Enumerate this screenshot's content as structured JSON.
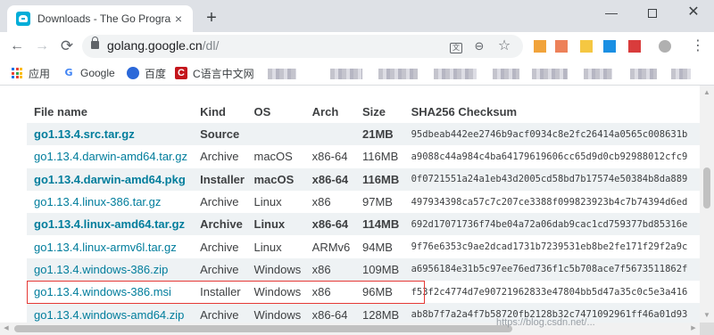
{
  "browser": {
    "tab_title": "Downloads - The Go Programming Language",
    "tab_close": "×",
    "new_tab": "+",
    "window_controls": {
      "minimize": "—",
      "close": "✕"
    },
    "nav": {
      "back": "←",
      "forward": "→",
      "reload": "⟳"
    },
    "url": {
      "host": "golang.google.cn",
      "path": "/dl/"
    },
    "omnibox_icons": {
      "translate": "文",
      "zoom": "⊖",
      "star": "☆"
    },
    "menu": "⋮",
    "extension_colors": [
      "#f1a33b",
      "#e8622f",
      "#f5c742",
      "#1a8fe3",
      "#d93c3c",
      "#7c7c7c"
    ]
  },
  "bookmarks": [
    {
      "label": "应用",
      "icon": "apps-grid-icon"
    },
    {
      "label": "Google",
      "icon": "google-g-icon",
      "glyph": "G"
    },
    {
      "label": "百度",
      "icon": "baidu-paw-icon"
    },
    {
      "label": "C语言中文网",
      "icon": "c-language-icon",
      "glyph": "C"
    }
  ],
  "downloads_table": {
    "headers": [
      "File name",
      "Kind",
      "OS",
      "Arch",
      "Size",
      "SHA256 Checksum"
    ],
    "rows": [
      {
        "file": "go1.13.4.src.tar.gz",
        "kind": "Source",
        "os": "",
        "arch": "",
        "size": "21MB",
        "checksum": "95dbeab442ee2746b9acf0934c8e2fc26414a0565c008631b",
        "featured": true
      },
      {
        "file": "go1.13.4.darwin-amd64.tar.gz",
        "kind": "Archive",
        "os": "macOS",
        "arch": "x86-64",
        "size": "116MB",
        "checksum": "a9088c44a984c4ba64179619606cc65d9d0cb92988012cfc9",
        "featured": false
      },
      {
        "file": "go1.13.4.darwin-amd64.pkg",
        "kind": "Installer",
        "os": "macOS",
        "arch": "x86-64",
        "size": "116MB",
        "checksum": "0f0721551a24a1eb43d2005cd58bd7b17574e50384b8da889",
        "featured": true
      },
      {
        "file": "go1.13.4.linux-386.tar.gz",
        "kind": "Archive",
        "os": "Linux",
        "arch": "x86",
        "size": "97MB",
        "checksum": "497934398ca57c7c207ce3388f099823923b4c7b74394d6ed",
        "featured": false
      },
      {
        "file": "go1.13.4.linux-amd64.tar.gz",
        "kind": "Archive",
        "os": "Linux",
        "arch": "x86-64",
        "size": "114MB",
        "checksum": "692d17071736f74be04a72a06dab9cac1cd759377bd85316e",
        "featured": true
      },
      {
        "file": "go1.13.4.linux-armv6l.tar.gz",
        "kind": "Archive",
        "os": "Linux",
        "arch": "ARMv6",
        "size": "94MB",
        "checksum": "9f76e6353c9ae2dcad1731b7239531eb8be2fe171f29f2a9c",
        "featured": false
      },
      {
        "file": "go1.13.4.windows-386.zip",
        "kind": "Archive",
        "os": "Windows",
        "arch": "x86",
        "size": "109MB",
        "checksum": "a6956184e31b5c97ee76ed736f1c5b708ace7f5673511862f",
        "featured": false
      },
      {
        "file": "go1.13.4.windows-386.msi",
        "kind": "Installer",
        "os": "Windows",
        "arch": "x86",
        "size": "96MB",
        "checksum": "f53f2c4774d7e90721962833e47804bb5d47a35c0c5e3a416",
        "featured": false,
        "highlighted": true
      },
      {
        "file": "go1.13.4.windows-amd64.zip",
        "kind": "Archive",
        "os": "Windows",
        "arch": "x86-64",
        "size": "128MB",
        "checksum": "ab8b7f7a2a4f7b58720fb2128b32c7471092961ff46a01d93",
        "featured": false
      }
    ]
  },
  "highlight_color": "#e53935",
  "link_color": "#007d9c",
  "watermark": "https://blog.csdn.net/..."
}
